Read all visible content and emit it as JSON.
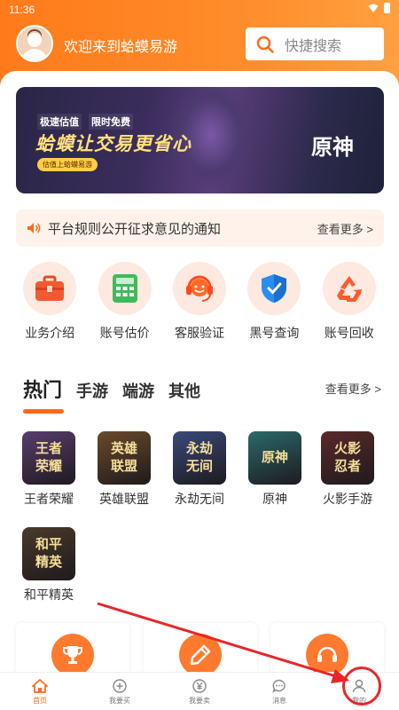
{
  "status_bar": {
    "time": "11:36"
  },
  "header": {
    "welcome": "欢迎来到蛤蟆易游",
    "search_placeholder": "快捷搜索"
  },
  "banner": {
    "tag1": "极速估值",
    "tag2": "限时免费",
    "headline": "蛤蟆让交易更省心",
    "sub_tag": "估值上蛤蟆易游",
    "game": "原神"
  },
  "notice": {
    "text": "平台规则公开征求意见的通知",
    "more": "查看更多 >"
  },
  "services": [
    {
      "label": "业务介绍",
      "icon": "briefcase-icon"
    },
    {
      "label": "账号估价",
      "icon": "calculator-icon"
    },
    {
      "label": "客服验证",
      "icon": "headset-icon"
    },
    {
      "label": "黑号查询",
      "icon": "shield-icon"
    },
    {
      "label": "账号回收",
      "icon": "recycle-icon"
    }
  ],
  "hot": {
    "tabs": [
      "热门",
      "手游",
      "端游",
      "其他"
    ],
    "more": "查看更多 >",
    "games": [
      {
        "tile": "王者\n荣耀",
        "name": "王者荣耀",
        "color": "#5a3d6e"
      },
      {
        "tile": "英雄\n联盟",
        "name": "英雄联盟",
        "color": "#6a4a2a"
      },
      {
        "tile": "永劫\n无间",
        "name": "永劫无间",
        "color": "#3a4a7a"
      },
      {
        "tile": "原神",
        "name": "原神",
        "color": "#2a6a6a"
      },
      {
        "tile": "火影\n忍者",
        "name": "火影手游",
        "color": "#5a2a2a"
      },
      {
        "tile": "和平\n精英",
        "name": "和平精英",
        "color": "#4a3a2a"
      }
    ]
  },
  "bottom_nav": [
    {
      "label": "首页",
      "icon": "home-icon",
      "active": true
    },
    {
      "label": "我要买",
      "icon": "plus-circle-icon",
      "active": false
    },
    {
      "label": "我要卖",
      "icon": "yen-circle-icon",
      "active": false
    },
    {
      "label": "消息",
      "icon": "message-icon",
      "active": false
    },
    {
      "label": "我的",
      "icon": "user-icon",
      "active": false
    }
  ],
  "colors": {
    "brand": "#ff7a1a",
    "accent": "#ff6a1a",
    "annotation": "#e8262a"
  }
}
